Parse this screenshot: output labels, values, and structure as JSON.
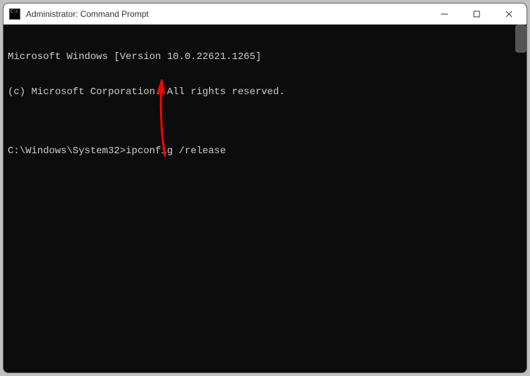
{
  "titlebar": {
    "title": "Administrator: Command Prompt"
  },
  "terminal": {
    "line1": "Microsoft Windows [Version 10.0.22621.1265]",
    "line2": "(c) Microsoft Corporation. All rights reserved.",
    "blank": "",
    "prompt": "C:\\Windows\\System32>",
    "command": "ipconfig /release"
  },
  "annotation": {
    "arrow_color": "#ff0000"
  }
}
